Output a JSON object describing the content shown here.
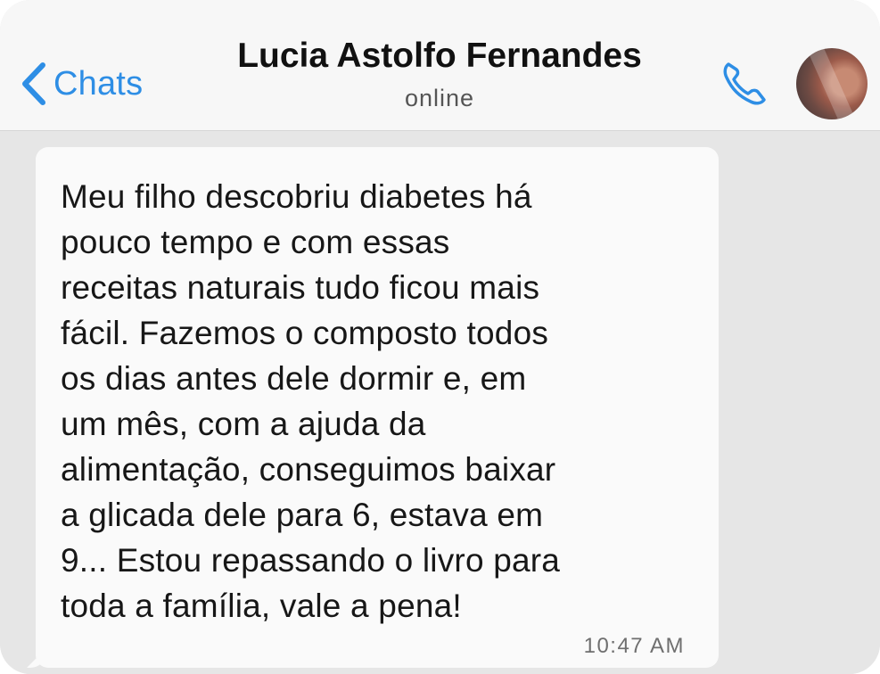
{
  "header": {
    "back_label": "Chats",
    "contact_name": "Lucia Astolfo Fernandes",
    "status": "online",
    "call_icon": "phone-icon",
    "avatar": "contact-avatar"
  },
  "message": {
    "lines": [
      "Meu filho descobriu diabetes há",
      "pouco tempo e com essas",
      "receitas naturais tudo ficou mais",
      "fácil. Fazemos o composto todos",
      "os dias antes dele dormir e, em",
      "um mês, com a ajuda da",
      "alimentação, conseguimos baixar",
      "a glicada dele para 6, estava em",
      "9... Estou repassando o livro para",
      "toda a família, vale a pena!"
    ],
    "time": "10:47 AM"
  },
  "colors": {
    "accent": "#2e8ee5",
    "header_bg": "#f7f7f7",
    "chat_bg": "#e6e6e6",
    "bubble_bg": "#fafafa"
  }
}
